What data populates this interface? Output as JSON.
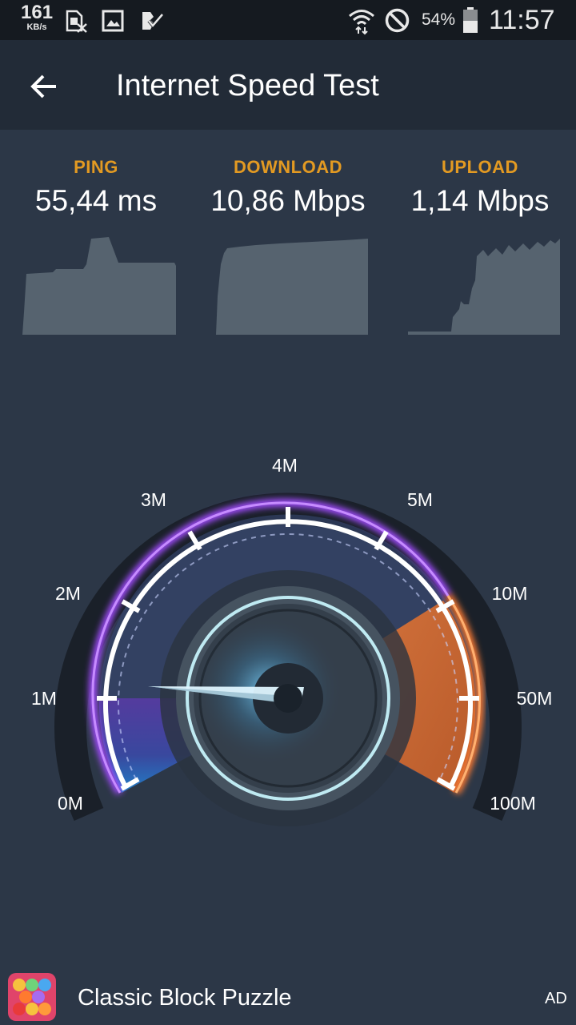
{
  "status_bar": {
    "net_speed": "161",
    "net_speed_unit": "KB/s",
    "battery": "54%",
    "time": "11:57",
    "icons": [
      "sim-card-off-icon",
      "gallery-icon",
      "check-icon",
      "wifi-icon",
      "blocked-icon",
      "battery-icon"
    ]
  },
  "app_bar": {
    "title": "Internet Speed Test",
    "back_icon": "arrow-left-icon"
  },
  "results": {
    "ping": {
      "label": "PING",
      "value": "55,44 ms"
    },
    "download": {
      "label": "DOWNLOAD",
      "value": "10,86 Mbps"
    },
    "upload": {
      "label": "UPLOAD",
      "value": "1,14 Mbps"
    }
  },
  "gauge": {
    "labels": [
      "0M",
      "1M",
      "2M",
      "3M",
      "4M",
      "5M",
      "10M",
      "50M",
      "100M"
    ],
    "needle_value": "1M"
  },
  "ad": {
    "title": "Classic Block Puzzle",
    "tag": "AD"
  },
  "colors": {
    "accent": "#e39a22",
    "background": "#2c3747",
    "app_bar": "#222b37",
    "status_bar": "#151a20",
    "gauge_purple": "#9b4dff",
    "gauge_orange": "#f08a3c"
  }
}
